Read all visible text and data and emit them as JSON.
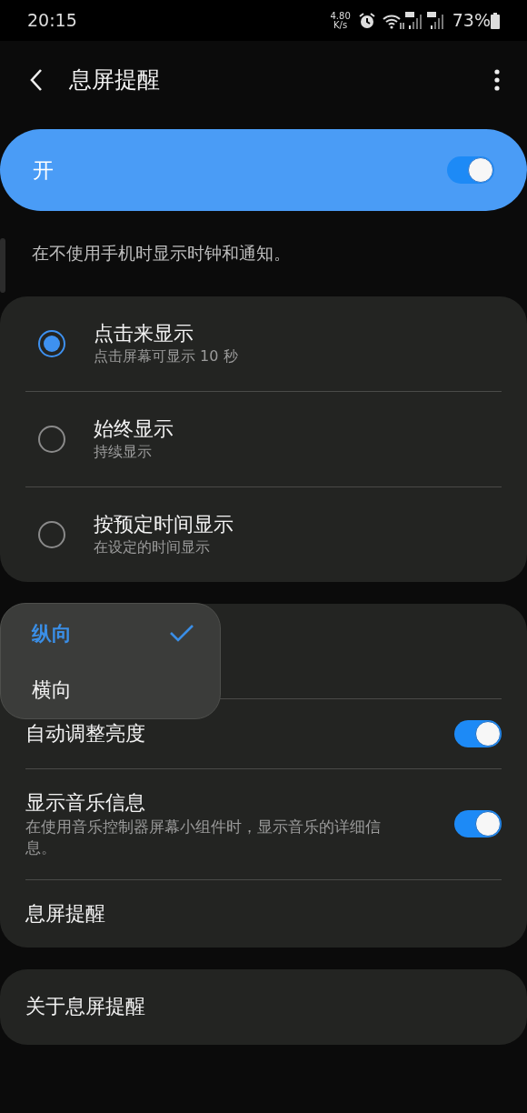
{
  "status_bar": {
    "time": "20:15",
    "net_speed": [
      "4.80",
      "K/s"
    ],
    "battery": "73%"
  },
  "app_bar": {
    "title": "息屏提醒"
  },
  "master_switch": {
    "label": "开",
    "on": true
  },
  "description": "在不使用手机时显示时钟和通知。",
  "display_modes": [
    {
      "title": "点击来显示",
      "subtitle": "点击屏幕可显示 10 秒",
      "selected": true
    },
    {
      "title": "始终显示",
      "subtitle": "持续显示",
      "selected": false
    },
    {
      "title": "按预定时间显示",
      "subtitle": "在设定的时间显示",
      "selected": false
    }
  ],
  "orientation_menu": [
    {
      "label": "纵向",
      "selected": true
    },
    {
      "label": "横向",
      "selected": false
    }
  ],
  "settings": [
    {
      "kind": "switch",
      "title": "自动调整亮度",
      "on": true
    },
    {
      "kind": "switch",
      "title": "显示音乐信息",
      "subtitle": "在使用音乐控制器屏幕小组件时，显示音乐的详细信息。",
      "on": true
    },
    {
      "kind": "link",
      "title": "息屏提醒"
    }
  ],
  "about": {
    "title": "关于息屏提醒"
  }
}
